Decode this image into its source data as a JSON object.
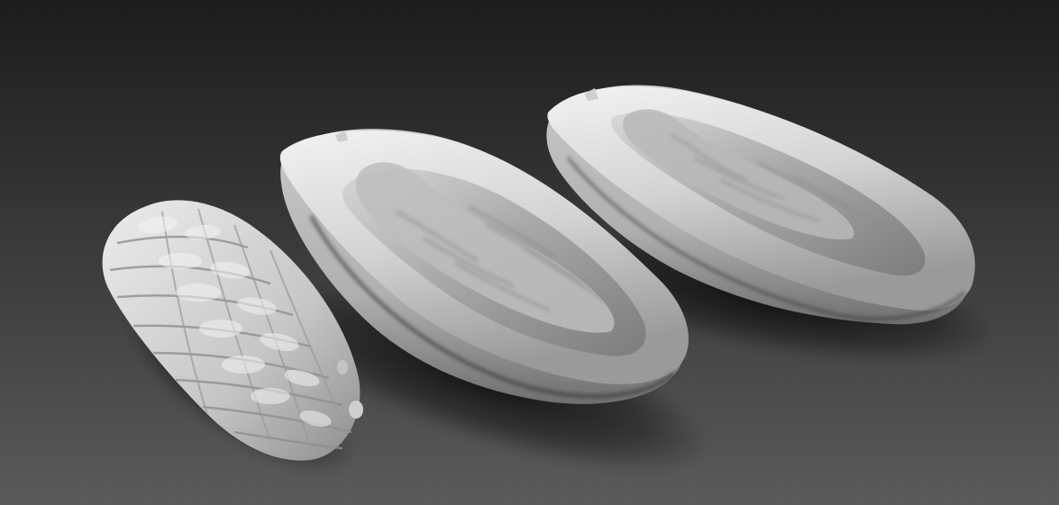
{
  "scene": {
    "background_top": "#1c1c1c",
    "background_bottom": "#595959",
    "clay_color": "#c8c8c8",
    "objects": [
      {
        "name": "cocoa-bean-cluster-model"
      },
      {
        "name": "cocoa-pod-half-front-model"
      },
      {
        "name": "cocoa-pod-half-back-model"
      }
    ]
  }
}
